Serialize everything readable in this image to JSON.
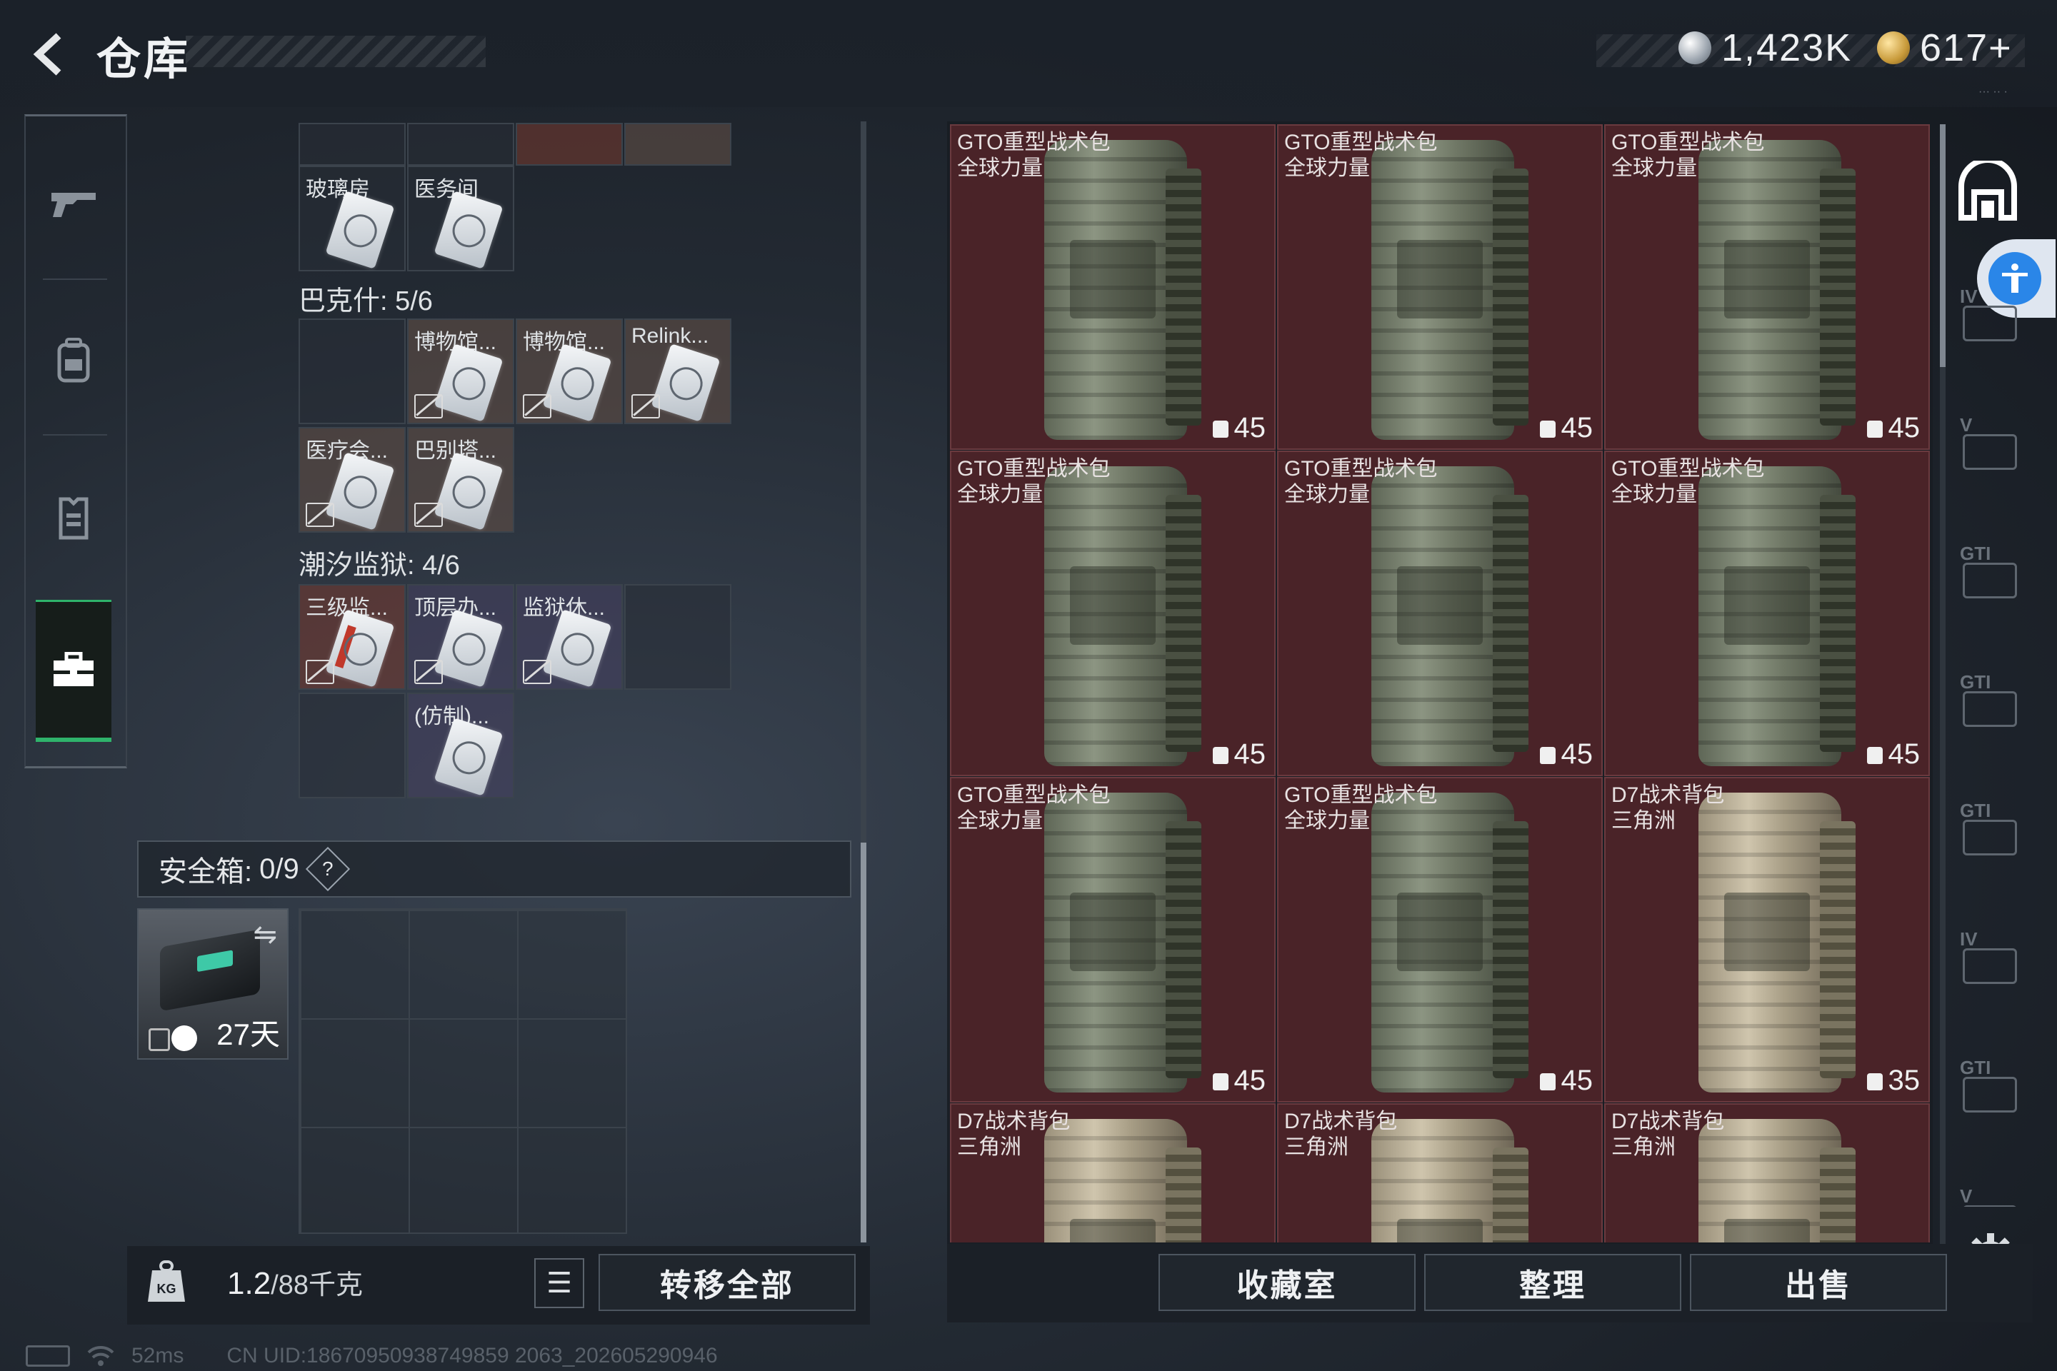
{
  "header": {
    "title": "仓库",
    "currency_silver": "1,423K",
    "currency_gold": "617+",
    "tiny_text": "··· ·· ·"
  },
  "left_nav": {
    "items": [
      {
        "name": "weapon-icon"
      },
      {
        "name": "backpack-icon"
      },
      {
        "name": "armor-icon"
      },
      {
        "name": "toolbox-icon",
        "active": true
      }
    ]
  },
  "keycards": {
    "top_row_labels": [
      "玻璃房",
      "医务间"
    ],
    "bakesh": {
      "label": "巴克什: 5/6",
      "items": [
        "博物馆...",
        "博物馆...",
        "Relink...",
        "医疗会...",
        "巴别塔..."
      ]
    },
    "prison": {
      "label": "潮汐监狱: 4/6",
      "items": [
        "三级监...",
        "顶层办...",
        "监狱休...",
        "(仿制)..."
      ]
    }
  },
  "safe_box": {
    "label": "安全箱:",
    "count": "0/9",
    "help": "?",
    "days": "27天"
  },
  "bottom_left": {
    "weight_icon_text": "KG",
    "weight_value": "1.2",
    "weight_capacity": "/88千克",
    "transfer_all": "转移全部"
  },
  "bags": [
    {
      "name": "GTO重型战术包",
      "sub": "全球力量",
      "capacity": "45",
      "tan": false
    },
    {
      "name": "GTO重型战术包",
      "sub": "全球力量",
      "capacity": "45",
      "tan": false
    },
    {
      "name": "GTO重型战术包",
      "sub": "全球力量",
      "capacity": "45",
      "tan": false
    },
    {
      "name": "GTO重型战术包",
      "sub": "全球力量",
      "capacity": "45",
      "tan": false
    },
    {
      "name": "GTO重型战术包",
      "sub": "全球力量",
      "capacity": "45",
      "tan": false
    },
    {
      "name": "GTO重型战术包",
      "sub": "全球力量",
      "capacity": "45",
      "tan": false
    },
    {
      "name": "GTO重型战术包",
      "sub": "全球力量",
      "capacity": "45",
      "tan": false
    },
    {
      "name": "GTO重型战术包",
      "sub": "全球力量",
      "capacity": "45",
      "tan": false
    },
    {
      "name": "D7战术背包",
      "sub": "三角洲",
      "capacity": "35",
      "tan": true
    },
    {
      "name": "D7战术背包",
      "sub": "三角洲",
      "capacity": "",
      "tan": true
    },
    {
      "name": "D7战术背包",
      "sub": "三角洲",
      "capacity": "",
      "tan": true
    },
    {
      "name": "D7战术背包",
      "sub": "三角洲",
      "capacity": "",
      "tan": true
    }
  ],
  "side_tabs": [
    "IV",
    "V",
    "GTI",
    "GTI",
    "GTI",
    "IV",
    "GTI",
    "V"
  ],
  "bottom_right": {
    "collection": "收藏室",
    "sort": "整理",
    "sell": "出售"
  },
  "status_bar": {
    "ping": "52ms",
    "uid": "CN UID:18670950938749859 2063_202605290946"
  }
}
